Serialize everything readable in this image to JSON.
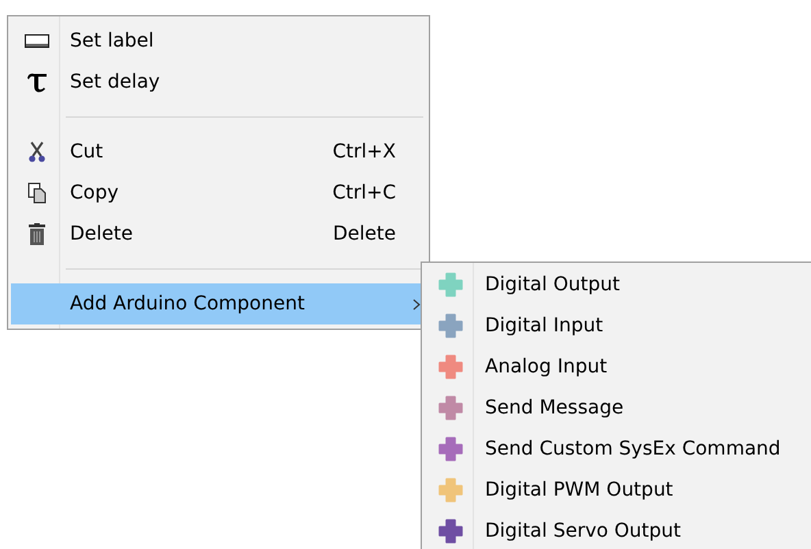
{
  "context_menu": {
    "items": [
      {
        "kind": "item",
        "label": "Set label",
        "selected": false
      },
      {
        "kind": "item",
        "label": "Set delay",
        "selected": false
      },
      {
        "kind": "separator"
      },
      {
        "kind": "item",
        "label": "Cut",
        "shortcut": "Ctrl+X",
        "selected": false
      },
      {
        "kind": "item",
        "label": "Copy",
        "shortcut": "Ctrl+C",
        "selected": false
      },
      {
        "kind": "item",
        "label": "Delete",
        "shortcut": "Delete",
        "selected": false
      },
      {
        "kind": "separator"
      },
      {
        "kind": "submenu",
        "label": "Add Arduino Component",
        "selected": true
      }
    ]
  },
  "submenu": {
    "items": [
      {
        "label": "Digital Output",
        "color": "#7fd3c0"
      },
      {
        "label": "Digital Input",
        "color": "#8aa4bf"
      },
      {
        "label": "Analog Input",
        "color": "#ef8a80"
      },
      {
        "label": "Send Message",
        "color": "#c08aa6"
      },
      {
        "label": "Send Custom SysEx Command",
        "color": "#a66cba"
      },
      {
        "label": "Digital PWM Output",
        "color": "#f0c47a"
      },
      {
        "label": "Digital Servo Output",
        "color": "#6f4fa3"
      }
    ]
  }
}
